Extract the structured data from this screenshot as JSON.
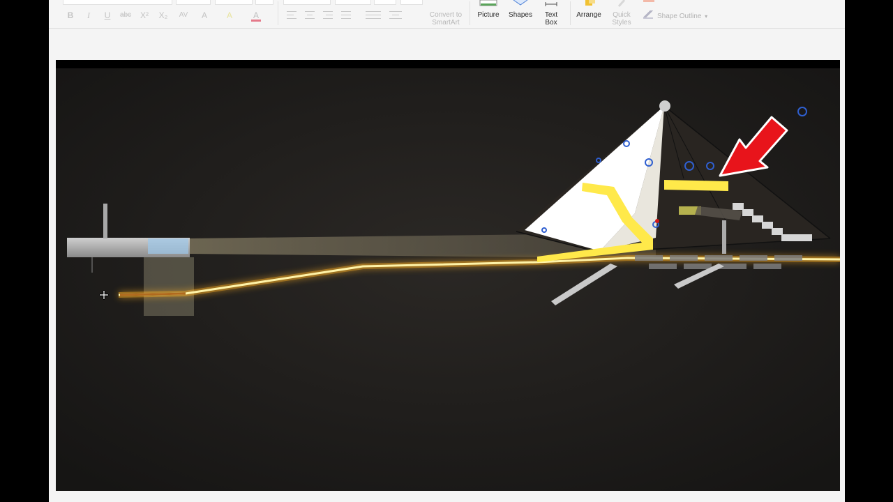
{
  "ribbon": {
    "format_buttons": [
      "B",
      "I",
      "U",
      "abc",
      "X²",
      "X₂",
      "AV",
      "A",
      "A"
    ],
    "convert": {
      "line1": "Convert to",
      "line2": "SmartArt"
    },
    "insert": {
      "picture": "Picture",
      "shapes": "Shapes",
      "textbox_line1": "Text",
      "textbox_line2": "Box"
    },
    "arrange": "Arrange",
    "quick_styles": {
      "line1": "Quick",
      "line2": "Styles"
    },
    "shape_outline": "Shape Outline",
    "dropdown_caret": "▾"
  },
  "slide": {
    "background": "#1e1c1a",
    "laser_color": "#ffd44a",
    "arrow_color": "#e8141b",
    "pyramid_light": "#ffffff",
    "pyramid_dark": "#2a2622",
    "selection_handle_color": "#2f5fd0"
  },
  "icons": {
    "cursor": "move-cursor-icon",
    "pointer": "red-arrow-annotation"
  }
}
